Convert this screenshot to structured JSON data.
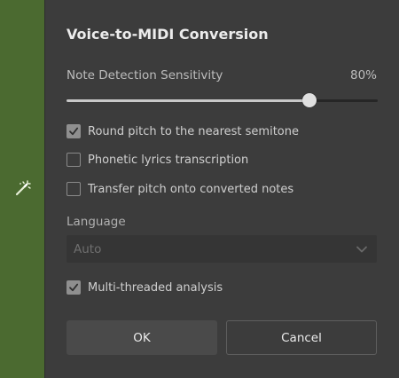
{
  "dialog": {
    "title": "Voice-to-MIDI Conversion",
    "side_icon": "magic-wand-icon",
    "accent_color": "#4b6a30"
  },
  "sensitivity": {
    "label": "Note Detection Sensitivity",
    "value_text": "80%",
    "value": 0.8
  },
  "options": {
    "round_pitch": {
      "label": "Round pitch to the nearest semitone",
      "checked": true
    },
    "phonetic_lyrics": {
      "label": "Phonetic lyrics transcription",
      "checked": false
    },
    "transfer_pitch": {
      "label": "Transfer pitch onto converted notes",
      "checked": false
    },
    "multithreaded": {
      "label": "Multi-threaded analysis",
      "checked": true
    }
  },
  "language": {
    "label": "Language",
    "selected": "Auto",
    "chevron_icon": "chevron-down-icon"
  },
  "buttons": {
    "ok_label": "OK",
    "cancel_label": "Cancel"
  }
}
